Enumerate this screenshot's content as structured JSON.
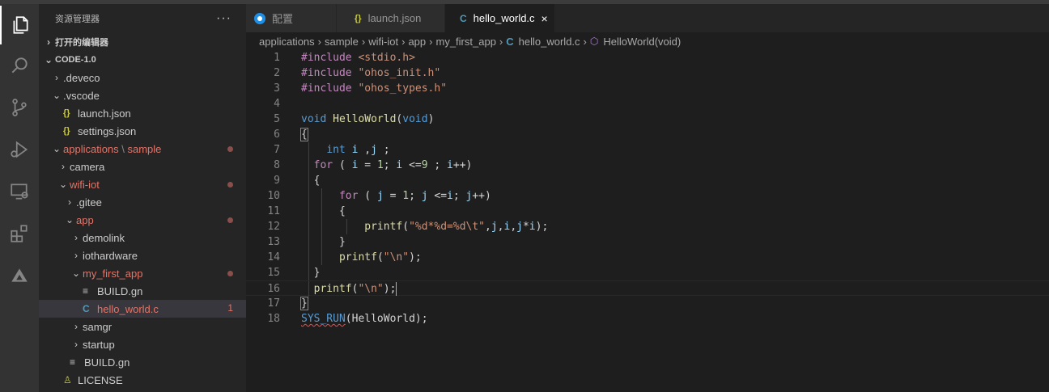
{
  "sidebar": {
    "title": "资源管理器",
    "more": "···",
    "open_editors": "打开的编辑器",
    "workspace": "CODE-1.0",
    "path_sep": "\\",
    "tree": [
      {
        "label": "deveco",
        "prefix": ".",
        "type": "folder",
        "depth": 0,
        "state": "collapsed"
      },
      {
        "label": "vscode",
        "prefix": ".",
        "type": "folder",
        "depth": 0,
        "state": "expanded"
      },
      {
        "label": "launch.json",
        "type": "json",
        "depth": 1
      },
      {
        "label": "settings.json",
        "type": "json",
        "depth": 1
      },
      {
        "label": "applications",
        "label2": "sample",
        "type": "folder",
        "depth": 0,
        "state": "expanded",
        "modified": true
      },
      {
        "label": "camera",
        "type": "folder",
        "depth": 1,
        "state": "collapsed"
      },
      {
        "label": "wifi-iot",
        "type": "folder",
        "depth": 1,
        "state": "expanded",
        "modified": true
      },
      {
        "label": "gitee",
        "prefix": ".",
        "type": "folder",
        "depth": 2,
        "state": "collapsed"
      },
      {
        "label": "app",
        "type": "folder",
        "depth": 2,
        "state": "expanded",
        "modified": true
      },
      {
        "label": "demolink",
        "type": "folder",
        "depth": 3,
        "state": "collapsed"
      },
      {
        "label": "iothardware",
        "type": "folder",
        "depth": 3,
        "state": "collapsed"
      },
      {
        "label": "my_first_app",
        "type": "folder",
        "depth": 3,
        "state": "expanded",
        "modified": true
      },
      {
        "label": "BUILD.gn",
        "type": "gn",
        "depth": 4
      },
      {
        "label": "hello_world.c",
        "type": "c",
        "depth": 4,
        "modified": true,
        "selected": true,
        "badge": "1"
      },
      {
        "label": "samgr",
        "type": "folder",
        "depth": 3,
        "state": "collapsed"
      },
      {
        "label": "startup",
        "type": "folder",
        "depth": 3,
        "state": "collapsed"
      },
      {
        "label": "BUILD.gn",
        "type": "gn",
        "depth": 2
      },
      {
        "label": "LICENSE",
        "type": "license",
        "depth": 1
      }
    ]
  },
  "tabs": [
    {
      "label": "配置",
      "icon": "config-icon",
      "active": false
    },
    {
      "label": "launch.json",
      "icon": "json-icon",
      "active": false
    },
    {
      "label": "hello_world.c",
      "icon": "c-file-icon",
      "active": true,
      "close": "×"
    }
  ],
  "breadcrumb": {
    "parts": [
      "applications",
      "sample",
      "wifi-iot",
      "app",
      "my_first_app"
    ],
    "file": "hello_world.c",
    "symbol": "HelloWorld(void)"
  },
  "icons": {
    "json": "{}",
    "c": "C",
    "gn": "≡",
    "license": "♙"
  },
  "editor": {
    "current_line": 16,
    "lines": [
      {
        "n": "1",
        "guides": 0,
        "t": [
          [
            "ctl",
            "#include"
          ],
          [
            "",
            " "
          ],
          [
            "str",
            "<stdio.h>"
          ]
        ]
      },
      {
        "n": "2",
        "guides": 0,
        "t": [
          [
            "ctl",
            "#include"
          ],
          [
            "",
            " "
          ],
          [
            "str",
            "\"ohos_init.h\""
          ]
        ]
      },
      {
        "n": "3",
        "guides": 0,
        "t": [
          [
            "ctl",
            "#include"
          ],
          [
            "",
            " "
          ],
          [
            "str",
            "\"ohos_types.h\""
          ]
        ]
      },
      {
        "n": "4",
        "guides": 0,
        "t": []
      },
      {
        "n": "5",
        "guides": 0,
        "t": [
          [
            "kw",
            "void"
          ],
          [
            "",
            " "
          ],
          [
            "fn",
            "HelloWorld"
          ],
          [
            "",
            "("
          ],
          [
            "kw",
            "void"
          ],
          [
            "",
            ")"
          ]
        ]
      },
      {
        "n": "6",
        "guides": 0,
        "t": [
          [
            "br",
            "{"
          ]
        ]
      },
      {
        "n": "7",
        "guides": 1,
        "t": [
          [
            "",
            "    "
          ],
          [
            "kw",
            "int"
          ],
          [
            "",
            " "
          ],
          [
            "var",
            "i"
          ],
          [
            "",
            " ,"
          ],
          [
            "var",
            "j"
          ],
          [
            "",
            " ;"
          ]
        ]
      },
      {
        "n": "8",
        "guides": 1,
        "t": [
          [
            "",
            "  "
          ],
          [
            "ctl",
            "for"
          ],
          [
            "",
            " ( "
          ],
          [
            "var",
            "i"
          ],
          [
            "",
            " = "
          ],
          [
            "num",
            "1"
          ],
          [
            "",
            "; "
          ],
          [
            "var",
            "i"
          ],
          [
            "",
            " <="
          ],
          [
            "num",
            "9"
          ],
          [
            "",
            " ; "
          ],
          [
            "var",
            "i"
          ],
          [
            "",
            "++)"
          ]
        ]
      },
      {
        "n": "9",
        "guides": 1,
        "t": [
          [
            "",
            "  {"
          ]
        ]
      },
      {
        "n": "10",
        "guides": 2,
        "t": [
          [
            "",
            "      "
          ],
          [
            "ctl",
            "for"
          ],
          [
            "",
            " ( "
          ],
          [
            "var",
            "j"
          ],
          [
            "",
            " = "
          ],
          [
            "num",
            "1"
          ],
          [
            "",
            "; "
          ],
          [
            "var",
            "j"
          ],
          [
            "",
            " <="
          ],
          [
            "var",
            "i"
          ],
          [
            "",
            "; "
          ],
          [
            "var",
            "j"
          ],
          [
            "",
            "++)"
          ]
        ]
      },
      {
        "n": "11",
        "guides": 2,
        "t": [
          [
            "",
            "      {"
          ]
        ]
      },
      {
        "n": "12",
        "guides": 3,
        "t": [
          [
            "",
            "          "
          ],
          [
            "fn",
            "printf"
          ],
          [
            "",
            "("
          ],
          [
            "str",
            "\"%d*%d=%d\\t\""
          ],
          [
            "",
            ","
          ],
          [
            "var",
            "j"
          ],
          [
            "",
            ","
          ],
          [
            "var",
            "i"
          ],
          [
            "",
            ","
          ],
          [
            "var",
            "j"
          ],
          [
            "",
            "*"
          ],
          [
            "var",
            "i"
          ],
          [
            "",
            ");"
          ]
        ]
      },
      {
        "n": "13",
        "guides": 2,
        "t": [
          [
            "",
            "      }"
          ]
        ]
      },
      {
        "n": "14",
        "guides": 2,
        "t": [
          [
            "",
            "      "
          ],
          [
            "fn",
            "printf"
          ],
          [
            "",
            "("
          ],
          [
            "str",
            "\"\\n\""
          ],
          [
            "",
            ");"
          ]
        ]
      },
      {
        "n": "15",
        "guides": 1,
        "t": [
          [
            "",
            "  }"
          ]
        ]
      },
      {
        "n": "16",
        "guides": 1,
        "t": [
          [
            "",
            "  "
          ],
          [
            "fn",
            "printf"
          ],
          [
            "",
            "("
          ],
          [
            "str",
            "\"\\n\""
          ],
          [
            "",
            ");"
          ],
          [
            "cursor",
            ""
          ]
        ]
      },
      {
        "n": "17",
        "guides": 0,
        "t": [
          [
            "br",
            "}"
          ]
        ]
      },
      {
        "n": "18",
        "guides": 0,
        "t": [
          [
            "squiggle kw",
            "SYS_RUN"
          ],
          [
            "",
            "("
          ],
          [
            "",
            "HelloWorld"
          ],
          [
            "",
            ");"
          ]
        ]
      }
    ]
  }
}
